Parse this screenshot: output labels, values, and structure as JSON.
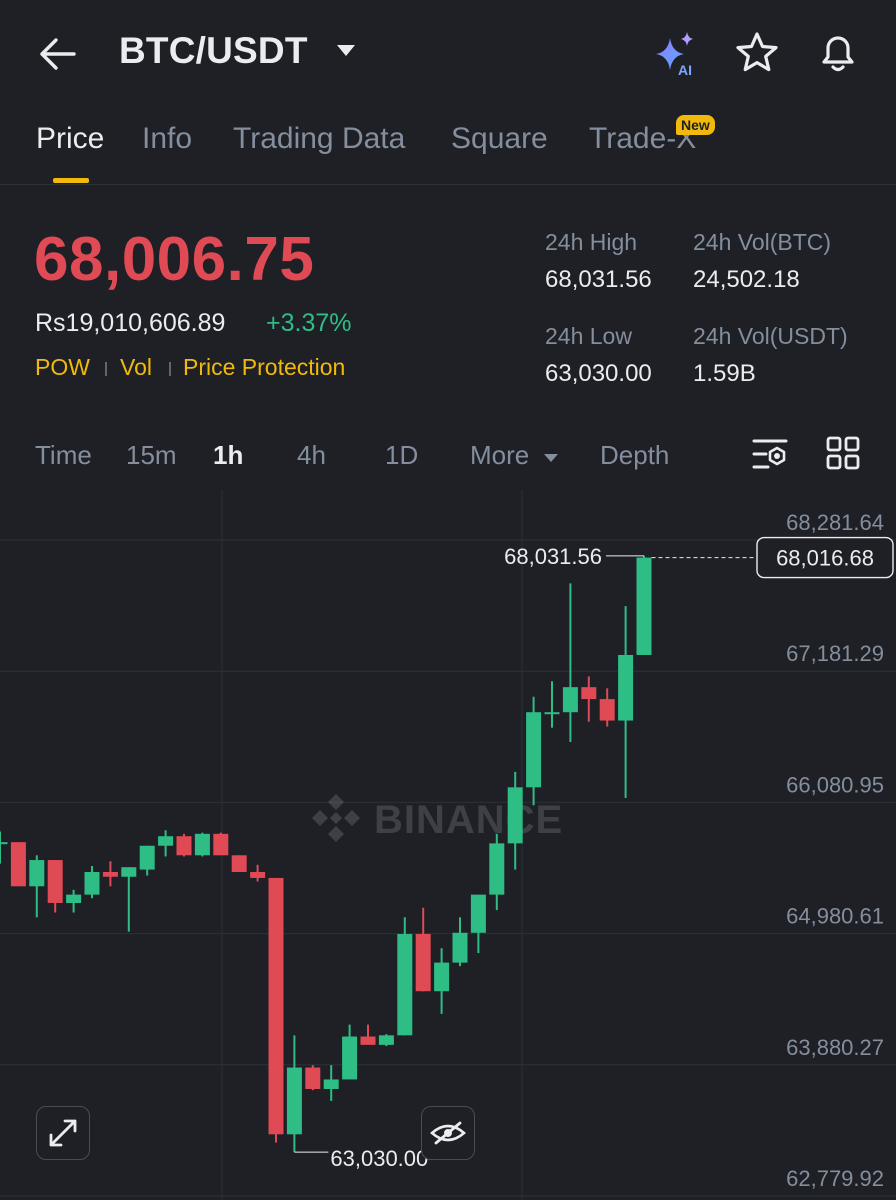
{
  "header": {
    "pair": "BTC/USDT",
    "icons": [
      "back-arrow-icon",
      "caret-down-icon",
      "ai-sparkle-icon",
      "star-icon",
      "bell-icon"
    ],
    "ai_label": "AI"
  },
  "tabs": [
    {
      "label": "Price",
      "active": true
    },
    {
      "label": "Info"
    },
    {
      "label": "Trading Data"
    },
    {
      "label": "Square"
    },
    {
      "label": "Trade-X",
      "badge": "New"
    }
  ],
  "price": {
    "last": "68,006.75",
    "fiat": "Rs19,010,606.89",
    "change": "+3.37%",
    "tags": [
      "POW",
      "Vol",
      "Price Protection"
    ],
    "high_label": "24h High",
    "high_value": "68,031.56",
    "vol_btc_label": "24h Vol(BTC)",
    "vol_btc_value": "24,502.18",
    "low_label": "24h Low",
    "low_value": "63,030.00",
    "vol_usdt_label": "24h Vol(USDT)",
    "vol_usdt_value": "1.59B"
  },
  "intervals": {
    "items": [
      "Time",
      "15m",
      "1h",
      "4h",
      "1D",
      "More",
      "Depth"
    ],
    "active": "1h"
  },
  "colors": {
    "background": "#1e2026",
    "up": "#2ebd85",
    "down": "#e04a55",
    "accent": "#f0b90b",
    "muted": "#848e9c"
  },
  "chart_data": {
    "type": "candlestick",
    "interval": "1h",
    "watermark": "BINANCE",
    "yticks": [
      "68,281.64",
      "67,181.29",
      "66,080.95",
      "64,980.61",
      "63,880.27",
      "62,779.92"
    ],
    "ylim": [
      62779.92,
      68281.64
    ],
    "current_price_label": "68,016.68",
    "current_price": 68016.68,
    "high_marker": "68,031.56",
    "high_value": 68031.56,
    "low_marker": "63,030.00",
    "low_value": 63030.0,
    "candles": [
      {
        "o": 65630,
        "h": 65720,
        "l": 65450,
        "c": 65630
      },
      {
        "o": 65630,
        "h": 65630,
        "l": 65260,
        "c": 65260
      },
      {
        "o": 65260,
        "h": 65520,
        "l": 65000,
        "c": 65480
      },
      {
        "o": 65480,
        "h": 65480,
        "l": 65040,
        "c": 65120
      },
      {
        "o": 65120,
        "h": 65230,
        "l": 65040,
        "c": 65190
      },
      {
        "o": 65190,
        "h": 65430,
        "l": 65160,
        "c": 65380
      },
      {
        "o": 65380,
        "h": 65470,
        "l": 65260,
        "c": 65340
      },
      {
        "o": 65340,
        "h": 65420,
        "l": 64880,
        "c": 65420
      },
      {
        "o": 65400,
        "h": 65600,
        "l": 65350,
        "c": 65600
      },
      {
        "o": 65600,
        "h": 65730,
        "l": 65510,
        "c": 65680
      },
      {
        "o": 65680,
        "h": 65700,
        "l": 65510,
        "c": 65520
      },
      {
        "o": 65520,
        "h": 65710,
        "l": 65510,
        "c": 65700
      },
      {
        "o": 65700,
        "h": 65710,
        "l": 65520,
        "c": 65520
      },
      {
        "o": 65520,
        "h": 65520,
        "l": 65380,
        "c": 65380
      },
      {
        "o": 65380,
        "h": 65440,
        "l": 65300,
        "c": 65330
      },
      {
        "o": 65330,
        "h": 65330,
        "l": 63110,
        "c": 63180
      },
      {
        "o": 63180,
        "h": 64010,
        "l": 63030,
        "c": 63740
      },
      {
        "o": 63740,
        "h": 63760,
        "l": 63550,
        "c": 63560
      },
      {
        "o": 63560,
        "h": 63760,
        "l": 63460,
        "c": 63640
      },
      {
        "o": 63640,
        "h": 64100,
        "l": 63640,
        "c": 64000
      },
      {
        "o": 64000,
        "h": 64100,
        "l": 63980,
        "c": 63930
      },
      {
        "o": 63930,
        "h": 64020,
        "l": 63920,
        "c": 64010
      },
      {
        "o": 64010,
        "h": 65000,
        "l": 64010,
        "c": 64860
      },
      {
        "o": 64860,
        "h": 65080,
        "l": 64380,
        "c": 64380
      },
      {
        "o": 64380,
        "h": 64740,
        "l": 64190,
        "c": 64620
      },
      {
        "o": 64620,
        "h": 65000,
        "l": 64590,
        "c": 64870
      },
      {
        "o": 64870,
        "h": 65140,
        "l": 64700,
        "c": 65190
      },
      {
        "o": 65190,
        "h": 65700,
        "l": 65060,
        "c": 65620
      },
      {
        "o": 65620,
        "h": 66220,
        "l": 65400,
        "c": 66090
      },
      {
        "o": 66090,
        "h": 66850,
        "l": 65940,
        "c": 66720
      },
      {
        "o": 66720,
        "h": 66980,
        "l": 66590,
        "c": 66720
      },
      {
        "o": 66720,
        "h": 67800,
        "l": 66470,
        "c": 66930
      },
      {
        "o": 66930,
        "h": 67020,
        "l": 66640,
        "c": 66830
      },
      {
        "o": 66830,
        "h": 66920,
        "l": 66600,
        "c": 66650
      },
      {
        "o": 66650,
        "h": 67610,
        "l": 66000,
        "c": 67200
      },
      {
        "o": 67200,
        "h": 68031.56,
        "l": 67200,
        "c": 68016.68
      }
    ]
  }
}
